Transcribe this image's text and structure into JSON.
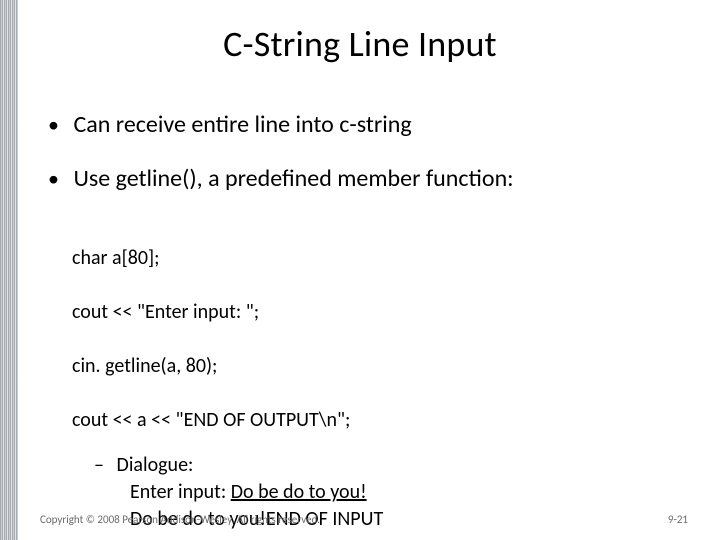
{
  "title": "C-String Line Input",
  "bullets": {
    "b1a": "Can receive entire line into c-string",
    "b1b": "Use getline(), a predefined member function:"
  },
  "code": {
    "l1": "char a[80];",
    "l2": "cout << \"Enter input: \";",
    "l3": "cin. getline(a, 80);",
    "l4": "cout << a << \"END OF OUTPUT\\n\";"
  },
  "dialogue": {
    "label": "Dialogue:",
    "line1_prefix": "Enter input: ",
    "line1_user": "Do be do to you!",
    "line2": "Do be do to you!END OF INPUT"
  },
  "footer": {
    "copyright": "Copyright © 2008 Pearson Addison-Wesley. All rights reserved.",
    "page": "9-21"
  }
}
